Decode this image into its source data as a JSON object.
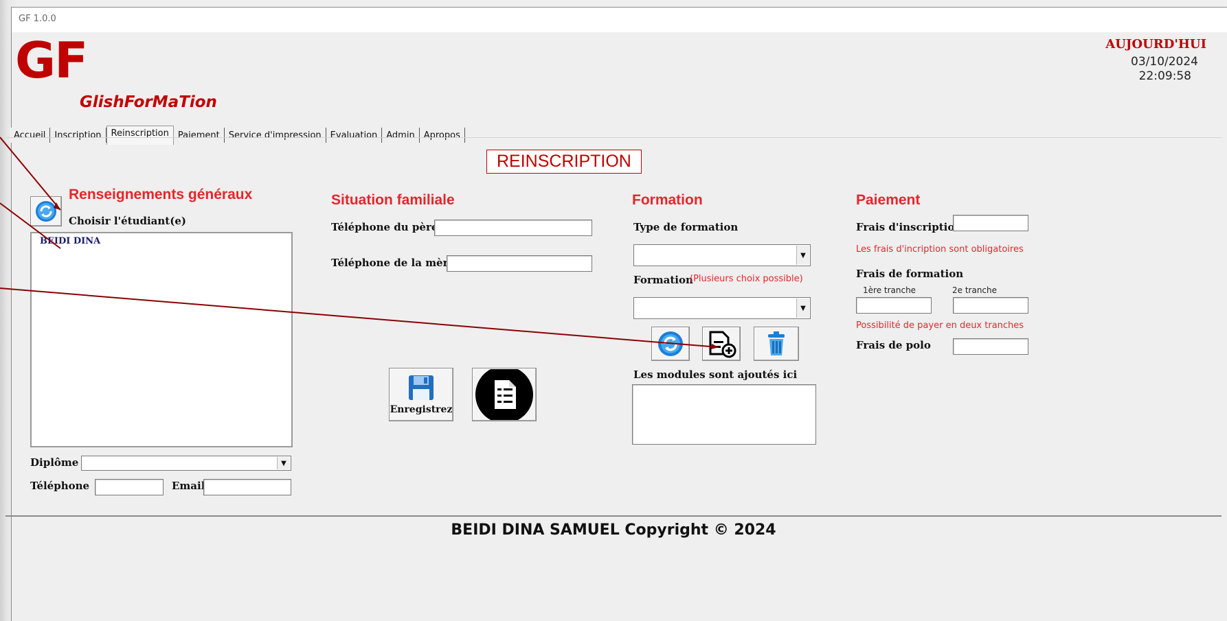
{
  "window": {
    "title": "GF 1.0.0",
    "close_glyph": "×"
  },
  "brand": {
    "logo": "GF",
    "name": "GlishForMaTion",
    "color": "#c00000"
  },
  "clock": {
    "label": "AUJOURD'HUI",
    "date": "03/10/2024",
    "time": "22:09:58"
  },
  "tabs": [
    "Accueil",
    "Inscription",
    "Reinscription",
    "Paiement",
    "Service d'impression",
    "Evaluation",
    "Admin",
    "Apropos"
  ],
  "active_tab": "Reinscription",
  "page_title": "REINSCRIPTION",
  "general": {
    "title": "Renseignements généraux",
    "refresh_icon": "refresh-icon",
    "choose_label": "Choisir l'étudiant(e)",
    "students": [
      "BEIDI DINA"
    ],
    "diploma_label": "Diplôme",
    "phone_label": "Téléphone",
    "email_label": "Email"
  },
  "family": {
    "title": "Situation familiale",
    "father_phone_label": "Téléphone du père",
    "mother_phone_label": "Téléphone de la mère"
  },
  "actions": {
    "save_label": "Enregistrez",
    "save_icon": "floppy-disk-icon",
    "checklist_icon": "checklist-document-icon"
  },
  "formation": {
    "title": "Formation",
    "type_label": "Type de formation",
    "formation_label": "Formation",
    "formation_hint": "(Plusieurs choix possible)",
    "refresh_icon": "refresh-icon",
    "add_icon": "add-document-icon",
    "delete_icon": "trash-icon",
    "modules_label": "Les modules sont ajoutés ici"
  },
  "payment": {
    "title": "Paiement",
    "registration_fee_label": "Frais d'inscription",
    "registration_note": "Les frais d'incription sont obligatoires",
    "training_fee_label": "Frais de formation",
    "first_installment": "1ère tranche",
    "second_installment": "2e tranche",
    "installments_note": "Possibilité de payer en deux tranches",
    "polo_fee_label": "Frais de polo"
  },
  "footer": "BEIDI DINA SAMUEL Copyright © 2024",
  "colors": {
    "accent_red": "#e8252b",
    "dark_red": "#c00000",
    "annotation": "#8b0000"
  }
}
